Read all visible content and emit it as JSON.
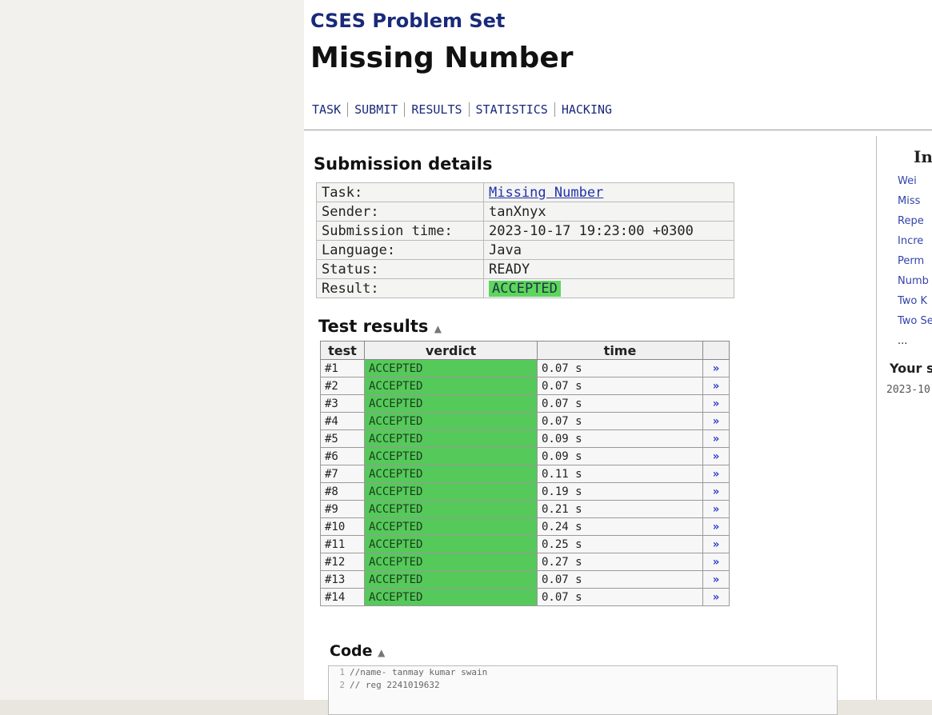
{
  "site": {
    "title": "CSES Problem Set"
  },
  "task": {
    "title": "Missing Number"
  },
  "nav": [
    "TASK",
    "SUBMIT",
    "RESULTS",
    "STATISTICS",
    "HACKING"
  ],
  "details": {
    "heading": "Submission details",
    "rows": [
      {
        "key": "Task:",
        "value": "Missing Number"
      },
      {
        "key": "Sender:",
        "value": "tanXnyx"
      },
      {
        "key": "Submission time:",
        "value": "2023-10-17 19:23:00 +0300"
      },
      {
        "key": "Language:",
        "value": "Java"
      },
      {
        "key": "Status:",
        "value": "READY"
      },
      {
        "key": "Result:",
        "value": "ACCEPTED"
      }
    ]
  },
  "tests": {
    "heading": "Test results",
    "columns": [
      "test",
      "verdict",
      "time"
    ],
    "rows": [
      {
        "test": "#1",
        "verdict": "ACCEPTED",
        "time": "0.07 s"
      },
      {
        "test": "#2",
        "verdict": "ACCEPTED",
        "time": "0.07 s"
      },
      {
        "test": "#3",
        "verdict": "ACCEPTED",
        "time": "0.07 s"
      },
      {
        "test": "#4",
        "verdict": "ACCEPTED",
        "time": "0.07 s"
      },
      {
        "test": "#5",
        "verdict": "ACCEPTED",
        "time": "0.09 s"
      },
      {
        "test": "#6",
        "verdict": "ACCEPTED",
        "time": "0.09 s"
      },
      {
        "test": "#7",
        "verdict": "ACCEPTED",
        "time": "0.11 s"
      },
      {
        "test": "#8",
        "verdict": "ACCEPTED",
        "time": "0.19 s"
      },
      {
        "test": "#9",
        "verdict": "ACCEPTED",
        "time": "0.21 s"
      },
      {
        "test": "#10",
        "verdict": "ACCEPTED",
        "time": "0.24 s"
      },
      {
        "test": "#11",
        "verdict": "ACCEPTED",
        "time": "0.25 s"
      },
      {
        "test": "#12",
        "verdict": "ACCEPTED",
        "time": "0.27 s"
      },
      {
        "test": "#13",
        "verdict": "ACCEPTED",
        "time": "0.07 s"
      },
      {
        "test": "#14",
        "verdict": "ACCEPTED",
        "time": "0.07 s"
      }
    ],
    "link_label": "»"
  },
  "code": {
    "heading": "Code",
    "lines": [
      {
        "n": "1",
        "text": "//name- tanmay kumar swain"
      },
      {
        "n": "2",
        "text": "// reg 2241019632"
      }
    ]
  },
  "sidebar": {
    "title": "In",
    "items": [
      "Wei",
      "Miss",
      "Repe",
      "Incre",
      "Perm",
      "Numb",
      "Two K",
      "Two Se",
      "..."
    ],
    "subheading": "Your s",
    "date": "2023-10"
  },
  "colors": {
    "accepted": "#5cd65c",
    "link": "#2233cc",
    "title": "#1a2a7a"
  }
}
